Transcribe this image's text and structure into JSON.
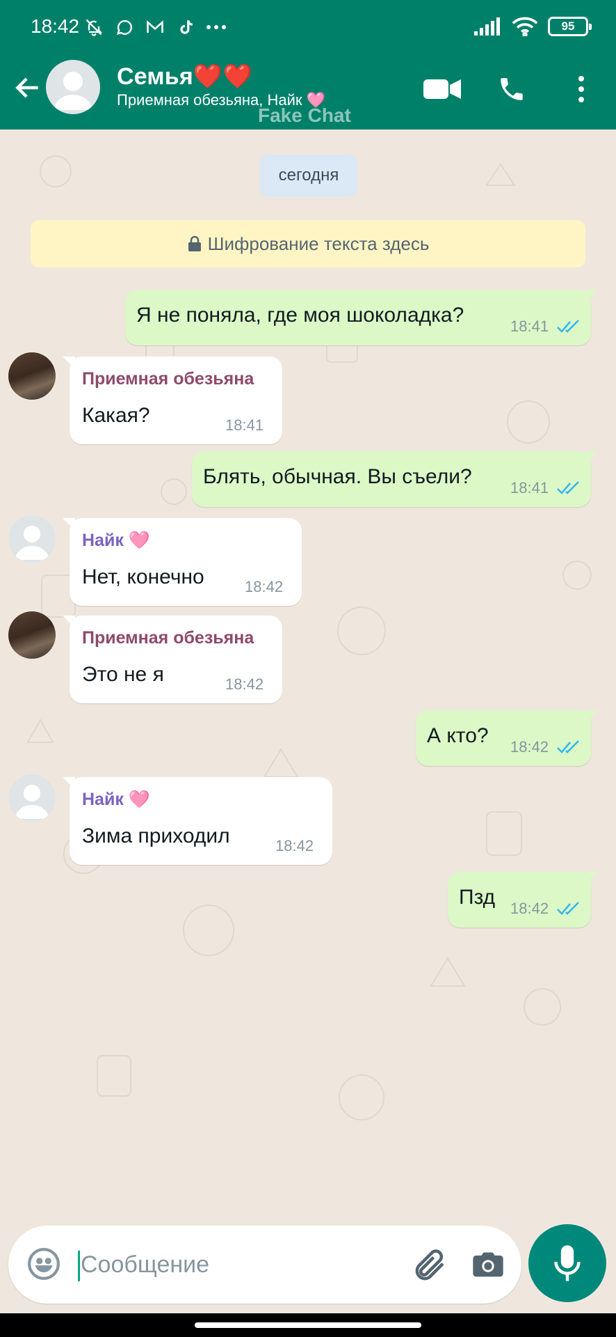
{
  "status_bar": {
    "time": "18:42",
    "battery": "95"
  },
  "header": {
    "title": "Семья❤️❤️",
    "subtitle": "Приемная обезьяна, Найк 🩷",
    "watermark": "Fake Chat",
    "accent": "#008069"
  },
  "chat": {
    "date_chip": "сегодня",
    "encryption": "Шифрование текста здесь",
    "messages": [
      {
        "dir": "out",
        "text": "Я не поняла, где моя шоколадка?",
        "time": "18:41",
        "status": "read"
      },
      {
        "dir": "in",
        "sender": "Приемная обезьяна",
        "text": "Какая?",
        "time": "18:41"
      },
      {
        "dir": "out",
        "text": "Блять, обычная. Вы съели?",
        "time": "18:41",
        "status": "read"
      },
      {
        "dir": "in",
        "sender": "Найк 🩷",
        "text": "Нет, конечно",
        "time": "18:42"
      },
      {
        "dir": "in",
        "sender": "Приемная обезьяна",
        "text": "Это не я",
        "time": "18:42"
      },
      {
        "dir": "out",
        "text": "А кто?",
        "time": "18:42",
        "status": "read"
      },
      {
        "dir": "in",
        "sender": "Найк 🩷",
        "text": "Зима приходил",
        "time": "18:42"
      },
      {
        "dir": "out",
        "text": "Пзд",
        "time": "18:42",
        "status": "read"
      }
    ],
    "sender_colors": {
      "monkey": "#8e4a6b",
      "nike": "#7b62c2"
    }
  },
  "composer": {
    "placeholder": "Сообщение",
    "value": ""
  }
}
